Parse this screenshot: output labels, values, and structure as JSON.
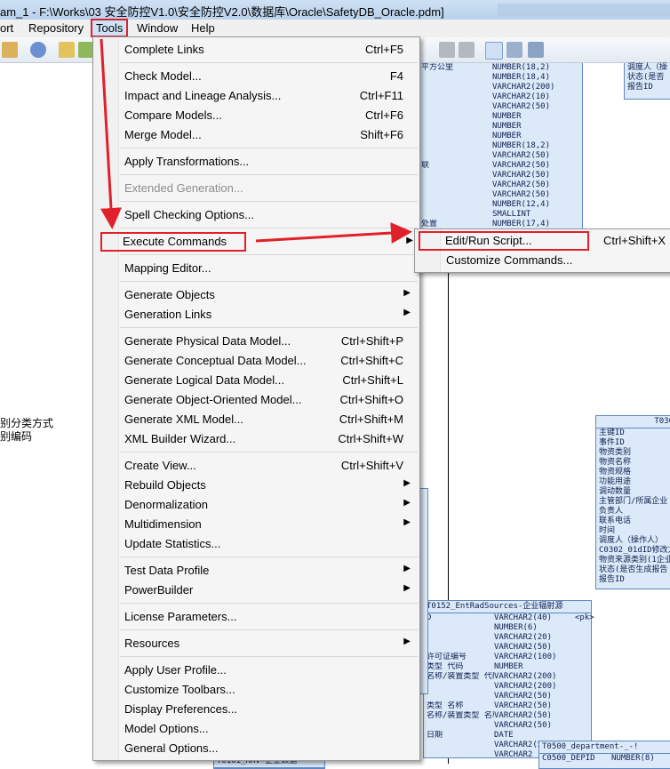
{
  "window": {
    "title": "am_1 - F:\\Works\\03 安全防控V1.0\\安全防控V2.0\\数据库\\Oracle\\SafetyDB_Oracle.pdm]"
  },
  "menubar": {
    "items": [
      "ort",
      "Repository",
      "Tools",
      "Window",
      "Help"
    ]
  },
  "left_pane": {
    "lines": [
      "别分类方式",
      "别编码"
    ]
  },
  "tools_menu": {
    "items": [
      {
        "label": "Complete Links",
        "shortcut": "Ctrl+F5"
      },
      {
        "label": "Check Model...",
        "shortcut": "F4"
      },
      {
        "label": "Impact and Lineage Analysis...",
        "shortcut": "Ctrl+F11"
      },
      {
        "label": "Compare Models...",
        "shortcut": "Ctrl+F6"
      },
      {
        "label": "Merge Model...",
        "shortcut": "Shift+F6"
      },
      {
        "label": "Apply Transformations...",
        "shortcut": ""
      },
      {
        "label": "Extended Generation...",
        "shortcut": "",
        "disabled": true
      },
      {
        "label": "Spell Checking Options...",
        "shortcut": ""
      },
      {
        "label": "Execute Commands",
        "shortcut": "",
        "submenu": true
      },
      {
        "label": "Mapping Editor...",
        "shortcut": ""
      },
      {
        "label": "Generate Objects",
        "shortcut": "",
        "submenu": true
      },
      {
        "label": "Generation Links",
        "shortcut": "",
        "submenu": true
      },
      {
        "label": "Generate Physical Data Model...",
        "shortcut": "Ctrl+Shift+P"
      },
      {
        "label": "Generate Conceptual Data Model...",
        "shortcut": "Ctrl+Shift+C"
      },
      {
        "label": "Generate Logical Data Model...",
        "shortcut": "Ctrl+Shift+L"
      },
      {
        "label": "Generate Object-Oriented Model...",
        "shortcut": "Ctrl+Shift+O"
      },
      {
        "label": "Generate XML Model...",
        "shortcut": "Ctrl+Shift+M"
      },
      {
        "label": "XML Builder Wizard...",
        "shortcut": "Ctrl+Shift+W"
      },
      {
        "label": "Create View...",
        "shortcut": "Ctrl+Shift+V"
      },
      {
        "label": "Rebuild Objects",
        "shortcut": "",
        "submenu": true
      },
      {
        "label": "Denormalization",
        "shortcut": "",
        "submenu": true
      },
      {
        "label": "Multidimension",
        "shortcut": "",
        "submenu": true
      },
      {
        "label": "Update Statistics...",
        "shortcut": ""
      },
      {
        "label": "Test Data Profile",
        "shortcut": "",
        "submenu": true
      },
      {
        "label": "PowerBuilder",
        "shortcut": "",
        "submenu": true
      },
      {
        "label": "License Parameters...",
        "shortcut": ""
      },
      {
        "label": "Resources",
        "shortcut": "",
        "submenu": true
      },
      {
        "label": "Apply User Profile...",
        "shortcut": ""
      },
      {
        "label": "Customize Toolbars...",
        "shortcut": ""
      },
      {
        "label": "Display Preferences...",
        "shortcut": ""
      },
      {
        "label": "Model Options...",
        "shortcut": ""
      },
      {
        "label": "General Options...",
        "shortcut": ""
      }
    ]
  },
  "execute_submenu": {
    "items": [
      {
        "label": "Edit/Run Script...",
        "shortcut": "Ctrl+Shift+X"
      },
      {
        "label": "Customize Commands...",
        "shortcut": ""
      }
    ]
  },
  "diagram": {
    "top_table": {
      "col1": [
        "平方公里",
        "",
        "",
        "",
        "",
        "",
        "",
        "",
        "",
        "",
        "联",
        "",
        "",
        "",
        "",
        "",
        "处置"
      ],
      "col2": [
        "NUMBER(18,2)",
        "NUMBER(18,4)",
        "VARCHAR2(200)",
        "VARCHAR2(10)",
        "VARCHAR2(50)",
        "NUMBER",
        "NUMBER",
        "NUMBER",
        "NUMBER(18,2)",
        "VARCHAR2(50)",
        "VARCHAR2(50)",
        "VARCHAR2(50)",
        "VARCHAR2(50)",
        "VARCHAR2(50)",
        "NUMBER(12,4)",
        "SMALLINT",
        "NUMBER(17,4)"
      ]
    },
    "top_right": {
      "rows": [
        "调度人（操",
        "状态(是否",
        "报告ID"
      ]
    },
    "t0302": {
      "title": "T030",
      "rows": [
        "主键ID",
        "事件ID",
        "物资类别",
        "物资名称",
        "物资规格",
        "功能用途",
        "调动数量",
        "主管部门/所属企业",
        "负责人",
        "联系电话",
        "时间",
        "调度人（操作人）",
        "C0302_01dID修改方",
        "物资来源类别(1企业",
        "状态(是否生成报告",
        "报告ID"
      ]
    },
    "t0152": {
      "title": "T0152_EntRadSources-企业辐射源",
      "col1": [
        "D",
        "",
        "",
        "",
        "许可证编号",
        "类型 代码",
        "名称/装置类型 代码",
        "",
        "",
        "类型 名称",
        "名称/装置类型 名称",
        "",
        "日期",
        "",
        ""
      ],
      "col2": [
        "VARCHAR2(40)",
        "NUMBER(6)",
        "VARCHAR2(20)",
        "VARCHAR2(50)",
        "VARCHAR2(100)",
        "NUMBER",
        "VARCHAR2(200)",
        "VARCHAR2(200)",
        "VARCHAR2(50)",
        "VARCHAR2(50)",
        "VARCHAR2(50)",
        "VARCHAR2(50)",
        "DATE",
        "VARCHAR2(50)",
        "VARCHAR2"
      ],
      "pk": "<pk>"
    },
    "t0500": {
      "title": "T0500_department-_-!",
      "row_name": "C0500_DEPID",
      "row_type": "NUMBER(8)"
    },
    "bottom_table": {
      "title": "T0101_HAV-企业数据"
    }
  }
}
